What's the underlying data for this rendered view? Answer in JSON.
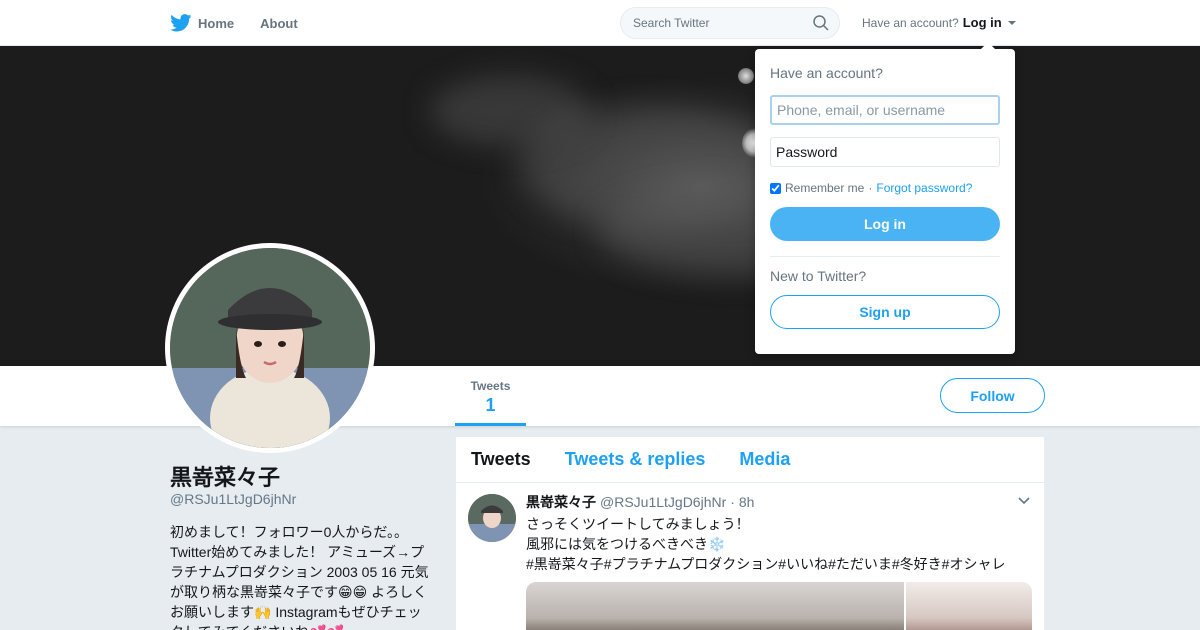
{
  "topbar": {
    "home_label": "Home",
    "about_label": "About",
    "search_placeholder": "Search Twitter",
    "have_account": "Have an account?",
    "login_label": "Log in"
  },
  "profile": {
    "name": "黒嵜菜々子",
    "handle": "@RSJu1LtJgD6jhNr",
    "bio": "初めまして！フォロワー0人からだ。。Twitter始めてみました！ アミューズ→プラチナムプロダクション 2003 05 16 元気が取り柄な黒嵜菜々子です😁😁 よろしくお願いします🙌 Instagramもぜひチェックしてみてくださいね💕💕"
  },
  "profile_nav": {
    "tweets_label": "Tweets",
    "tweets_count": "1",
    "follow_label": "Follow"
  },
  "timeline": {
    "tabs": [
      "Tweets",
      "Tweets & replies",
      "Media"
    ],
    "tweet": {
      "name": "黒嵜菜々子",
      "handle": "@RSJu1LtJgD6jhNr",
      "time": "· 8h",
      "lines": [
        "さっそくツイートしてみましょう！",
        "風邪には気をつけるべきべき❄️",
        "#黒嵜菜々子#プラチナムプロダクション#いいね#ただいま#冬好き#オシャレ"
      ]
    }
  },
  "login_dropdown": {
    "title": "Have an account?",
    "username_placeholder": "Phone, email, or username",
    "password_placeholder": "Password",
    "remember_label": "Remember me",
    "separator": "·",
    "forgot_label": "Forgot password?",
    "login_button": "Log in",
    "new_prompt": "New to Twitter?",
    "signup_button": "Sign up"
  },
  "colors": {
    "accent": "#1da1f2",
    "login_button_bg": "#4ab3f4",
    "page_bg": "#e6ecf0"
  },
  "icons": [
    "twitter-bird-icon",
    "search-icon",
    "caret-down-icon",
    "chevron-down-icon"
  ]
}
